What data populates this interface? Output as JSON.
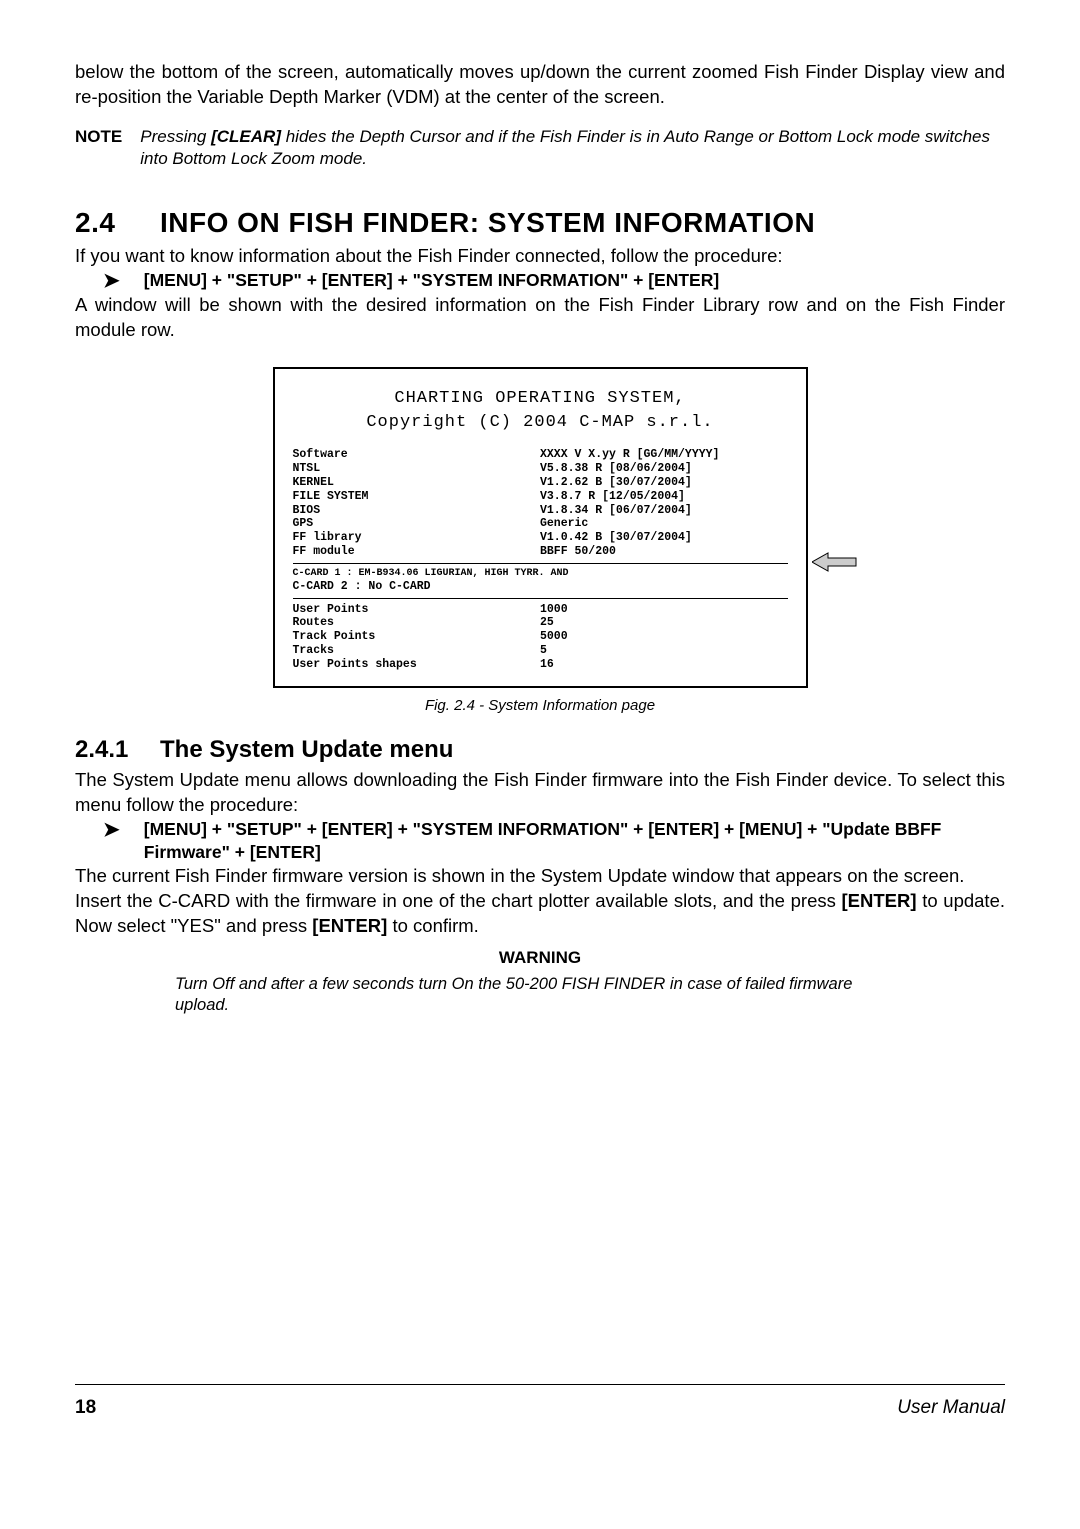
{
  "intro": {
    "para1": "below the bottom of the screen, automatically moves up/down the current zoomed Fish Finder Display view and re-position the Variable Depth Marker (VDM) at the center of the screen."
  },
  "note": {
    "label": "NOTE",
    "pre": "Pressing ",
    "key": "[CLEAR]",
    "post": " hides the Depth Cursor and if the Fish Finder is in Auto Range or Bottom Lock mode switches into Bottom Lock Zoom mode."
  },
  "section24": {
    "num": "2.4",
    "title": "INFO ON FISH FINDER: SYSTEM INFORMATION",
    "para1": "If you want to know information about the Fish Finder connected, follow the procedure:",
    "proc": "[MENU] + \"SETUP\" + [ENTER] + \"SYSTEM INFORMATION\" + [ENTER]",
    "para2": "A window will be shown with the desired information on the Fish Finder Library row and on the Fish Finder module row."
  },
  "figure": {
    "title1": "CHARTING OPERATING SYSTEM,",
    "title2": "Copyright (C) 2004 C-MAP s.r.l.",
    "rows1": [
      {
        "l": "Software",
        "r": "XXXX   V X.yy  R  [GG/MM/YYYY]"
      },
      {
        "l": "NTSL",
        "r": "V5.8.38 R [08/06/2004]"
      },
      {
        "l": "KERNEL",
        "r": "V1.2.62 B [30/07/2004]"
      },
      {
        "l": "FILE SYSTEM",
        "r": "V3.8.7 R [12/05/2004]"
      },
      {
        "l": "BIOS",
        "r": "V1.8.34 R [06/07/2004]"
      },
      {
        "l": "GPS",
        "r": "Generic"
      },
      {
        "l": "FF library",
        "r": "V1.0.42 B [30/07/2004]"
      },
      {
        "l": "FF module",
        "r": "BBFF 50/200"
      }
    ],
    "rows2": [
      {
        "l": "C-CARD 1 : EM-B934.06 LIGURIAN, HIGH TYRR. AND",
        "r": ""
      },
      {
        "l": "C-CARD 2 : No C-CARD",
        "r": ""
      }
    ],
    "rows3": [
      {
        "l": "User Points",
        "r": "1000"
      },
      {
        "l": "Routes",
        "r": "25"
      },
      {
        "l": "Track Points",
        "r": "5000"
      },
      {
        "l": "Tracks",
        "r": "5"
      },
      {
        "l": "User Points shapes",
        "r": "16"
      }
    ],
    "caption": "Fig. 2.4  - System Information page"
  },
  "section241": {
    "num": "2.4.1",
    "title": "The System Update menu",
    "para1": "The System Update menu allows downloading the Fish Finder firmware into the Fish Finder device. To select this menu follow the procedure:",
    "proc": "[MENU] + \"SETUP\" + [ENTER] + \"SYSTEM INFORMATION\" + [ENTER] + [MENU] + \"Update BBFF Firmware\" + [ENTER]",
    "para2_a": "The current Fish Finder firmware version is shown in the System Update window that appears on the screen.",
    "para2_b_pre": "Insert the C-CARD with the firmware in one of the chart plotter available slots, and the press ",
    "para2_b_key1": "[ENTER]",
    "para2_b_mid": " to update. Now select \"YES\" and press ",
    "para2_b_key2": "[ENTER]",
    "para2_b_post": " to confirm."
  },
  "warning": {
    "label": "WARNING",
    "text": "Turn Off and after a few seconds turn On the 50-200 FISH FINDER in case of failed firmware upload."
  },
  "footer": {
    "page": "18",
    "title": "User Manual"
  }
}
